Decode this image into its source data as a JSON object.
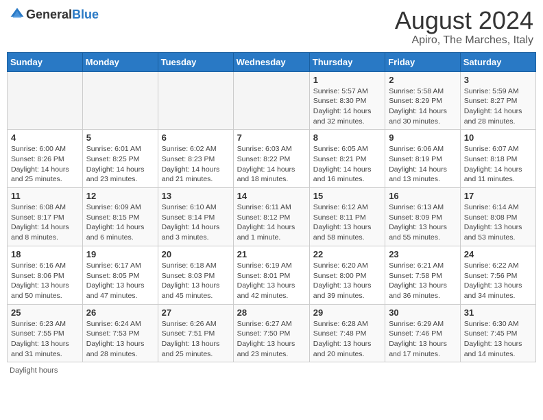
{
  "header": {
    "logo_general": "General",
    "logo_blue": "Blue",
    "main_title": "August 2024",
    "subtitle": "Apiro, The Marches, Italy"
  },
  "days_of_week": [
    "Sunday",
    "Monday",
    "Tuesday",
    "Wednesday",
    "Thursday",
    "Friday",
    "Saturday"
  ],
  "footer": {
    "label": "Daylight hours"
  },
  "weeks": [
    [
      {
        "day": "",
        "info": ""
      },
      {
        "day": "",
        "info": ""
      },
      {
        "day": "",
        "info": ""
      },
      {
        "day": "",
        "info": ""
      },
      {
        "day": "1",
        "info": "Sunrise: 5:57 AM\nSunset: 8:30 PM\nDaylight: 14 hours and 32 minutes."
      },
      {
        "day": "2",
        "info": "Sunrise: 5:58 AM\nSunset: 8:29 PM\nDaylight: 14 hours and 30 minutes."
      },
      {
        "day": "3",
        "info": "Sunrise: 5:59 AM\nSunset: 8:27 PM\nDaylight: 14 hours and 28 minutes."
      }
    ],
    [
      {
        "day": "4",
        "info": "Sunrise: 6:00 AM\nSunset: 8:26 PM\nDaylight: 14 hours and 25 minutes."
      },
      {
        "day": "5",
        "info": "Sunrise: 6:01 AM\nSunset: 8:25 PM\nDaylight: 14 hours and 23 minutes."
      },
      {
        "day": "6",
        "info": "Sunrise: 6:02 AM\nSunset: 8:23 PM\nDaylight: 14 hours and 21 minutes."
      },
      {
        "day": "7",
        "info": "Sunrise: 6:03 AM\nSunset: 8:22 PM\nDaylight: 14 hours and 18 minutes."
      },
      {
        "day": "8",
        "info": "Sunrise: 6:05 AM\nSunset: 8:21 PM\nDaylight: 14 hours and 16 minutes."
      },
      {
        "day": "9",
        "info": "Sunrise: 6:06 AM\nSunset: 8:19 PM\nDaylight: 14 hours and 13 minutes."
      },
      {
        "day": "10",
        "info": "Sunrise: 6:07 AM\nSunset: 8:18 PM\nDaylight: 14 hours and 11 minutes."
      }
    ],
    [
      {
        "day": "11",
        "info": "Sunrise: 6:08 AM\nSunset: 8:17 PM\nDaylight: 14 hours and 8 minutes."
      },
      {
        "day": "12",
        "info": "Sunrise: 6:09 AM\nSunset: 8:15 PM\nDaylight: 14 hours and 6 minutes."
      },
      {
        "day": "13",
        "info": "Sunrise: 6:10 AM\nSunset: 8:14 PM\nDaylight: 14 hours and 3 minutes."
      },
      {
        "day": "14",
        "info": "Sunrise: 6:11 AM\nSunset: 8:12 PM\nDaylight: 14 hours and 1 minute."
      },
      {
        "day": "15",
        "info": "Sunrise: 6:12 AM\nSunset: 8:11 PM\nDaylight: 13 hours and 58 minutes."
      },
      {
        "day": "16",
        "info": "Sunrise: 6:13 AM\nSunset: 8:09 PM\nDaylight: 13 hours and 55 minutes."
      },
      {
        "day": "17",
        "info": "Sunrise: 6:14 AM\nSunset: 8:08 PM\nDaylight: 13 hours and 53 minutes."
      }
    ],
    [
      {
        "day": "18",
        "info": "Sunrise: 6:16 AM\nSunset: 8:06 PM\nDaylight: 13 hours and 50 minutes."
      },
      {
        "day": "19",
        "info": "Sunrise: 6:17 AM\nSunset: 8:05 PM\nDaylight: 13 hours and 47 minutes."
      },
      {
        "day": "20",
        "info": "Sunrise: 6:18 AM\nSunset: 8:03 PM\nDaylight: 13 hours and 45 minutes."
      },
      {
        "day": "21",
        "info": "Sunrise: 6:19 AM\nSunset: 8:01 PM\nDaylight: 13 hours and 42 minutes."
      },
      {
        "day": "22",
        "info": "Sunrise: 6:20 AM\nSunset: 8:00 PM\nDaylight: 13 hours and 39 minutes."
      },
      {
        "day": "23",
        "info": "Sunrise: 6:21 AM\nSunset: 7:58 PM\nDaylight: 13 hours and 36 minutes."
      },
      {
        "day": "24",
        "info": "Sunrise: 6:22 AM\nSunset: 7:56 PM\nDaylight: 13 hours and 34 minutes."
      }
    ],
    [
      {
        "day": "25",
        "info": "Sunrise: 6:23 AM\nSunset: 7:55 PM\nDaylight: 13 hours and 31 minutes."
      },
      {
        "day": "26",
        "info": "Sunrise: 6:24 AM\nSunset: 7:53 PM\nDaylight: 13 hours and 28 minutes."
      },
      {
        "day": "27",
        "info": "Sunrise: 6:26 AM\nSunset: 7:51 PM\nDaylight: 13 hours and 25 minutes."
      },
      {
        "day": "28",
        "info": "Sunrise: 6:27 AM\nSunset: 7:50 PM\nDaylight: 13 hours and 23 minutes."
      },
      {
        "day": "29",
        "info": "Sunrise: 6:28 AM\nSunset: 7:48 PM\nDaylight: 13 hours and 20 minutes."
      },
      {
        "day": "30",
        "info": "Sunrise: 6:29 AM\nSunset: 7:46 PM\nDaylight: 13 hours and 17 minutes."
      },
      {
        "day": "31",
        "info": "Sunrise: 6:30 AM\nSunset: 7:45 PM\nDaylight: 13 hours and 14 minutes."
      }
    ]
  ]
}
